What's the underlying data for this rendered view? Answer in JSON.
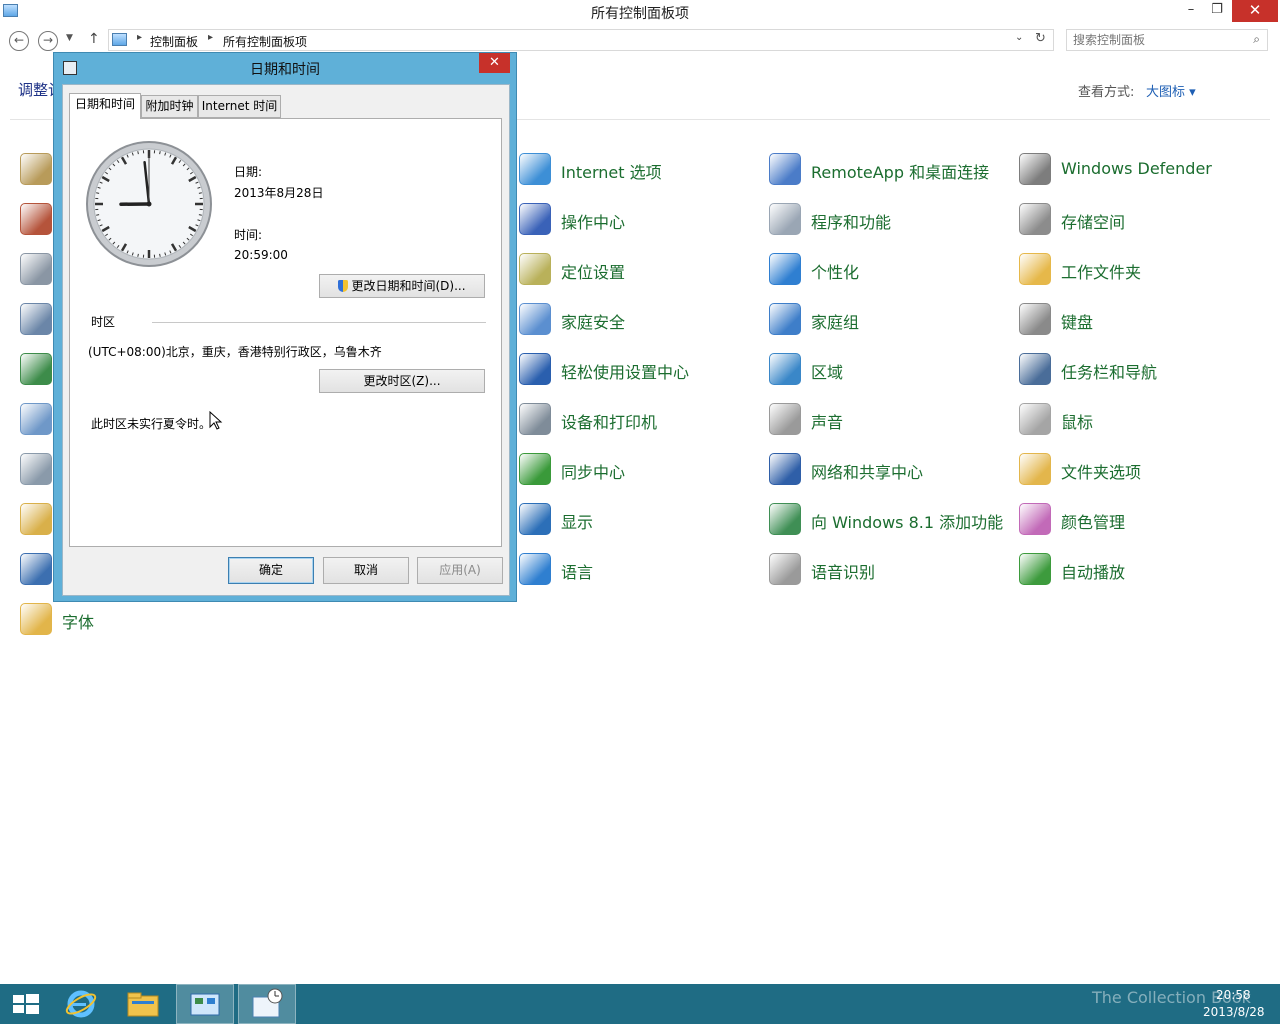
{
  "window": {
    "title": "所有控制面板项",
    "minimize": "–",
    "maximize": "❐",
    "close": "✕"
  },
  "navigation": {
    "back": "←",
    "forward": "→",
    "recent": "▼",
    "up": "↑",
    "breadcrumb": [
      "控制面板",
      "所有控制面板项"
    ],
    "separator": "▸",
    "dropdown": "⌄",
    "refresh": "↻",
    "search_placeholder": "搜索控制面板",
    "search_icon": "⌕"
  },
  "header": {
    "title": "调整计算机的设置",
    "view_by_label": "查看方式:",
    "view_by_value": "大图标 ▾"
  },
  "items": [
    {
      "label": "Internet 选项",
      "icon": "internet-options-icon",
      "color": "#3d8fd6"
    },
    {
      "label": "RemoteApp 和桌面连接",
      "icon": "remoteapp-icon",
      "color": "#4b7cc8"
    },
    {
      "label": "Windows Defender",
      "icon": "windows-defender-icon",
      "color": "#7d7d7d"
    },
    {
      "label": "操作中心",
      "icon": "action-center-icon",
      "color": "#3a62b8"
    },
    {
      "label": "程序和功能",
      "icon": "programs-features-icon",
      "color": "#9aa6b4"
    },
    {
      "label": "存储空间",
      "icon": "storage-spaces-icon",
      "color": "#8c8c8c"
    },
    {
      "label": "定位设置",
      "icon": "location-settings-icon",
      "color": "#b9b15a"
    },
    {
      "label": "个性化",
      "icon": "personalization-icon",
      "color": "#2f7fd1"
    },
    {
      "label": "工作文件夹",
      "icon": "work-folders-icon",
      "color": "#e6b84a"
    },
    {
      "label": "家庭安全",
      "icon": "family-safety-icon",
      "color": "#5b8fd0"
    },
    {
      "label": "家庭组",
      "icon": "homegroup-icon",
      "color": "#3e7ec9"
    },
    {
      "label": "键盘",
      "icon": "keyboard-icon",
      "color": "#8a8a8a"
    },
    {
      "label": "轻松使用设置中心",
      "icon": "ease-of-access-icon",
      "color": "#2a5fae"
    },
    {
      "label": "区域",
      "icon": "region-icon",
      "color": "#3a87c8"
    },
    {
      "label": "任务栏和导航",
      "icon": "taskbar-navigation-icon",
      "color": "#4a6d99"
    },
    {
      "label": "设备和打印机",
      "icon": "devices-printers-icon",
      "color": "#7f8c99"
    },
    {
      "label": "声音",
      "icon": "sound-icon",
      "color": "#9a9a9a"
    },
    {
      "label": "鼠标",
      "icon": "mouse-icon",
      "color": "#a5a5a5"
    },
    {
      "label": "同步中心",
      "icon": "sync-center-icon",
      "color": "#3a9a3a"
    },
    {
      "label": "网络和共享中心",
      "icon": "network-sharing-icon",
      "color": "#2f5fa8"
    },
    {
      "label": "文件夹选项",
      "icon": "folder-options-icon",
      "color": "#e3b64c"
    },
    {
      "label": "显示",
      "icon": "display-icon",
      "color": "#2c6fb8"
    },
    {
      "label": "向 Windows 8.1 添加功能",
      "icon": "add-features-icon",
      "color": "#3f8f55"
    },
    {
      "label": "颜色管理",
      "icon": "color-management-icon",
      "color": "#c26ab8"
    },
    {
      "label": "语言",
      "icon": "language-icon",
      "color": "#2f7fd0"
    },
    {
      "label": "语音识别",
      "icon": "speech-recognition-icon",
      "color": "#9a9a9a"
    },
    {
      "label": "自动播放",
      "icon": "autoplay-icon",
      "color": "#3d9b3d"
    },
    {
      "label": "字体",
      "icon": "fonts-icon",
      "color": "#e2b54a"
    }
  ],
  "left_column_icons": [
    {
      "icon": "credential-manager-icon",
      "color": "#b89b5a"
    },
    {
      "icon": "windows-firewall-icon",
      "color": "#b5543b"
    },
    {
      "icon": "phone-modem-icon",
      "color": "#8a96a4"
    },
    {
      "icon": "administrative-tools-icon",
      "color": "#6b86a8"
    },
    {
      "icon": "windows-update-icon",
      "color": "#3d8c4a"
    },
    {
      "icon": "date-time-icon",
      "color": "#6f98c8"
    },
    {
      "icon": "indexing-options-icon",
      "color": "#8a9aaa"
    },
    {
      "icon": "file-history-icon",
      "color": "#d9b04a"
    },
    {
      "icon": "default-programs-icon",
      "color": "#3c6fb0"
    }
  ],
  "dialog": {
    "title": "日期和时间",
    "close": "✕",
    "tabs": [
      "日期和时间",
      "附加时钟",
      "Internet 时间"
    ],
    "date_label": "日期:",
    "date_value": "2013年8月28日",
    "time_label": "时间:",
    "time_value": "20:59:00",
    "change_datetime_button": "更改日期和时间(D)...",
    "timezone_section_label": "时区",
    "timezone_value": "(UTC+08:00)北京，重庆，香港特别行政区，乌鲁木齐",
    "change_timezone_button": "更改时区(Z)...",
    "dst_note": "此时区未实行夏令时。",
    "ok_button": "确定",
    "cancel_button": "取消",
    "apply_button": "应用(A)"
  },
  "clock": {
    "hour": 20,
    "minute": 59,
    "second": 0
  },
  "taskbar": {
    "time": "20:58",
    "date": "2013/8/28",
    "watermark": "The Collection Book",
    "apps": [
      "start-button",
      "internet-explorer",
      "file-explorer",
      "control-panel",
      "date-time"
    ],
    "color": "#1f6c84"
  }
}
